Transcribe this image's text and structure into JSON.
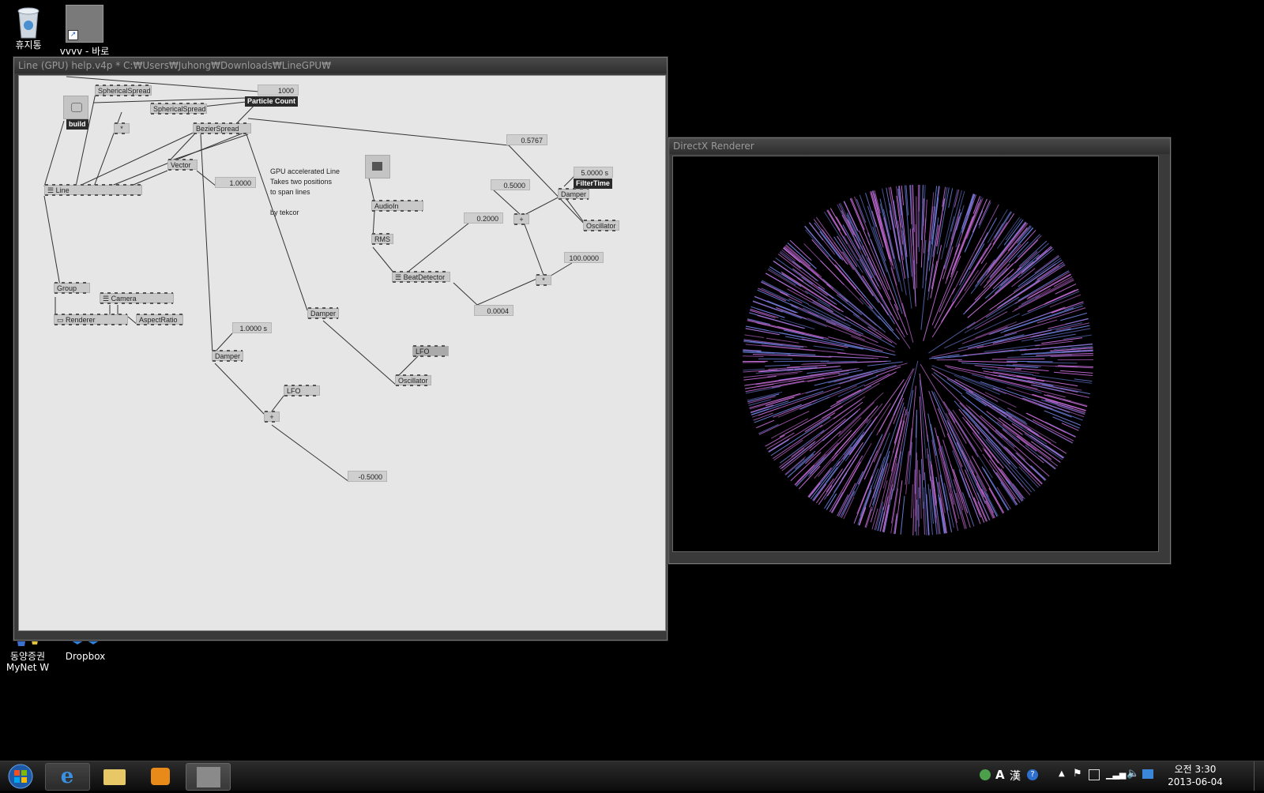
{
  "desktop": {
    "icons": [
      {
        "label": "휴지통",
        "icon": "recycle-bin-icon"
      },
      {
        "label": "vvvv - 바로",
        "icon": "vvvv-shortcut-icon"
      },
      {
        "label": "동양증권\nMyNet W",
        "icon": "mynet-shortcut-icon"
      },
      {
        "label": "Dropbox",
        "icon": "dropbox-icon"
      }
    ]
  },
  "patch_window": {
    "title": "Line (GPU) help.v4p *   C:₩Users₩Juhong₩Downloads₩LineGPU₩",
    "nodes": {
      "spherical1": "SphericalSpread",
      "spherical2": "SphericalSpread",
      "bezier": "BezierSpread",
      "vector": "Vector",
      "line": "Line",
      "group": "Group",
      "camera": "Camera",
      "renderer": "Renderer",
      "aspect": "AspectRatio",
      "damper1": "Damper",
      "damper2": "Damper",
      "damper3": "Damper",
      "lfo1": "LFO",
      "lfo2": "LFO",
      "plus1": "+",
      "plus2": "+",
      "mult1": "*",
      "mult2": "*",
      "audioin": "AudioIn",
      "rms": "RMS",
      "beat": "BeatDetector",
      "osc1": "Oscillator",
      "osc2": "Oscillator"
    },
    "values": {
      "particle_count": "1000",
      "v_05767": "0.5767",
      "v_1": "1.0000",
      "v_05": "0.5000",
      "v_02": "0.2000",
      "v_100": "100.0000",
      "v_00004": "0.0004",
      "v_1s": "1.0000 s",
      "v_neg05": "-0.5000",
      "v_5s": "5.0000 s"
    },
    "labels": {
      "build": "build",
      "particle_count": "Particle Count",
      "filter_time": "FilterTime"
    },
    "comment": "GPU accelerated Line\nTakes two positions\nto span lines\n\nby tekcor"
  },
  "renderer_window": {
    "title": "DirectX Renderer"
  },
  "tray": {
    "lang_a": "A",
    "lang_han": "漢",
    "time": "오전 3:30",
    "date": "2013-06-04"
  },
  "colors": {
    "desktop": "#000000",
    "patch_bg": "#e6e6e6",
    "node_bg": "#c9c9c9",
    "particle_a": "#c46bd6",
    "particle_b": "#6a7bd8"
  }
}
